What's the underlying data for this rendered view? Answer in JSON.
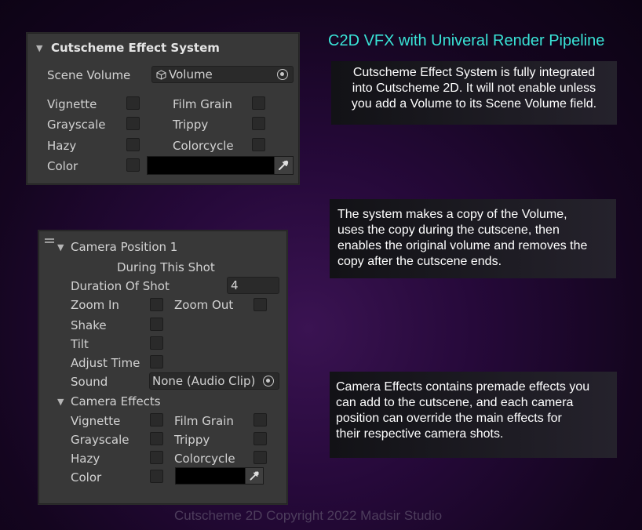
{
  "title": "C2D VFX with Univeral Render Pipeline",
  "copyright": "Cutscheme 2D Copyright 2022 Madsir Studio",
  "colors": {
    "title": "#39e3d6",
    "panel_bg": "#383838",
    "field_bg": "#2a2a2a"
  },
  "effect_panel": {
    "header": "Cutscheme Effect System",
    "scene_volume_label": "Scene Volume",
    "scene_volume_value": "Volume",
    "options": {
      "vignette": "Vignette",
      "film_grain": "Film Grain",
      "grayscale": "Grayscale",
      "trippy": "Trippy",
      "hazy": "Hazy",
      "colorcycle": "Colorcycle",
      "color": "Color"
    }
  },
  "camera_panel": {
    "header": "Camera Position 1",
    "subheader": "During This Shot",
    "duration_label": "Duration Of Shot",
    "duration_value": "4",
    "zoom_in": "Zoom In",
    "zoom_out": "Zoom Out",
    "shake": "Shake",
    "tilt": "Tilt",
    "adjust_time": "Adjust Time",
    "sound_label": "Sound",
    "sound_value": "None (Audio Clip)",
    "effects_header": "Camera Effects",
    "options": {
      "vignette": "Vignette",
      "film_grain": "Film Grain",
      "grayscale": "Grayscale",
      "trippy": "Trippy",
      "hazy": "Hazy",
      "colorcycle": "Colorcycle",
      "color": "Color"
    }
  },
  "info": {
    "box1": [
      "Cutscheme Effect System is fully integrated",
      "into Cutscheme 2D. It will not enable unless",
      "you add a Volume to its Scene Volume field."
    ],
    "box2": [
      "The system makes a copy of the Volume,",
      "uses the copy during the cutscene, then",
      "enables the original volume and removes the",
      "copy after the cutscene ends."
    ],
    "box3": [
      "Camera Effects contains premade effects you",
      "can add to the cutscene, and each camera",
      "position can override the main effects for",
      "their respective camera shots."
    ]
  }
}
